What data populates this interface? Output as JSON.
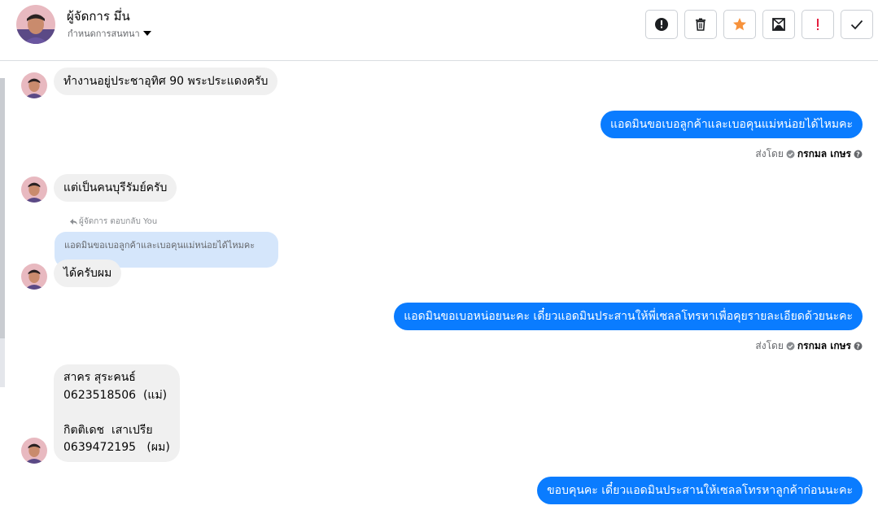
{
  "header": {
    "name": "ผู้จัดการ มึ่น",
    "subtitle": "กำหนดการสนทนา"
  },
  "toolbar": {
    "icons": [
      "alert-circle-icon",
      "trash-icon",
      "star-icon",
      "mailbox-icon",
      "exclamation-icon",
      "check-icon"
    ],
    "accent_star": "#f7923b",
    "accent_exclamation": "#e41e3f"
  },
  "colors": {
    "outgoing_bubble": "#0a7cff",
    "incoming_bubble": "#f0f0f0",
    "quoted_bubble": "#d5e6fb"
  },
  "messages": [
    {
      "direction": "in",
      "text": "ทำงานอยู่ประชาอุทิศ 90 พระประแดงครับ"
    },
    {
      "direction": "out",
      "text": "แอดมินขอเบอลูกค้าและเบอคุนแม่หน่อยได้ไหมคะ"
    },
    {
      "direction": "in",
      "text": "แต่เป็นคนบุรีรัมย์ครับ"
    },
    {
      "direction": "in",
      "text": "ได้ครับผม",
      "reply": {
        "label": "ผู้จัดการ ตอบกลับ You",
        "quoted": "แอดมินขอเบอลูกค้าและเบอคุนแม่หน่อยได้ไหมคะ"
      }
    },
    {
      "direction": "out",
      "text": "แอดมินขอเบอหน่อยนะคะ เดี๋ยวแอดมินประสานให้พี่เซลลโทรหาเพื่อคุยรายละเอียดด้วยนะคะ"
    },
    {
      "direction": "in",
      "text": "สาคร สุระคนธ์\n0623518506  (แม่)\n\nกิตติเดช  เสาเปรีย\n0639472195   (ผม)"
    },
    {
      "direction": "out",
      "text": "ขอบคุนคะ เดี๋ยวแอดมินประสานให้เซลลโทรหาลูกค้าก่อนนะคะ"
    }
  ],
  "sent_by": {
    "label": "ส่งโดย",
    "sender": "กรกมล เกษร"
  }
}
